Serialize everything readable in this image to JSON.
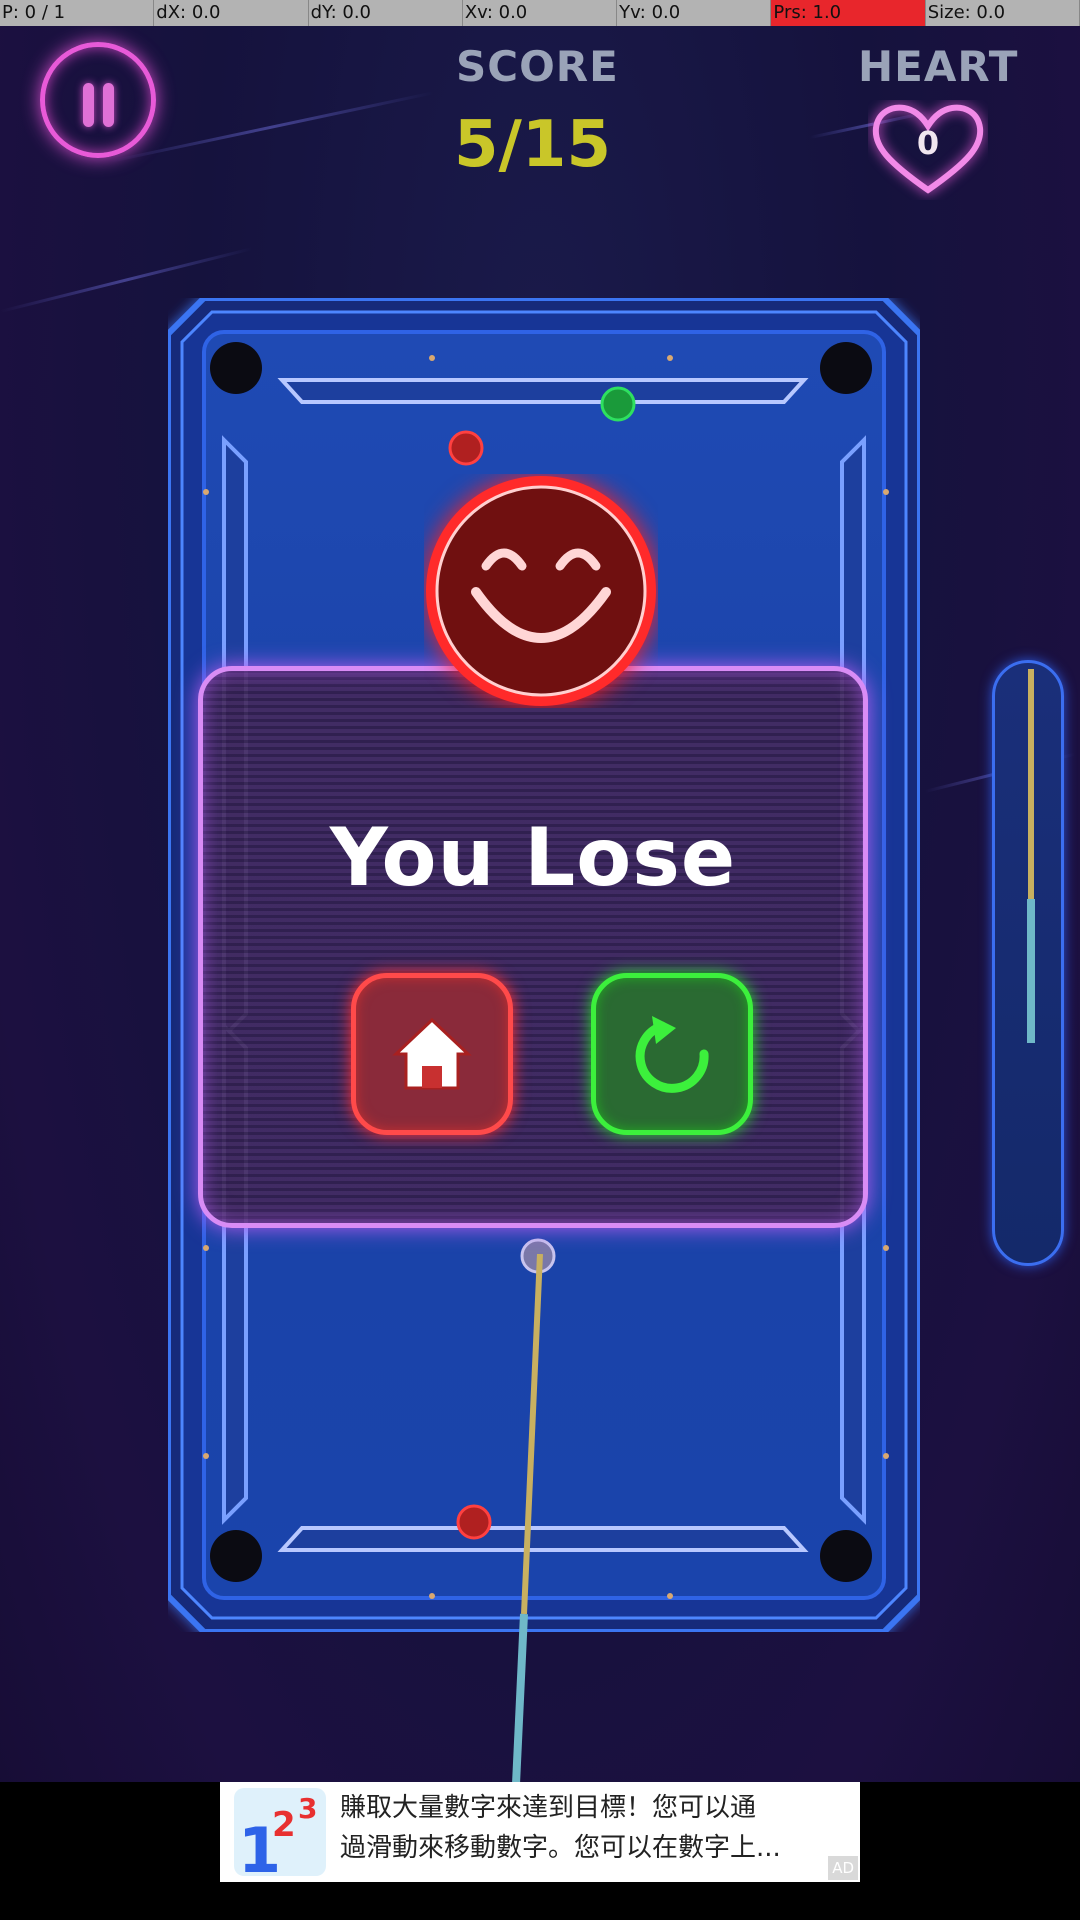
{
  "debug_bar": {
    "cells": [
      {
        "text": "P: 0 / 1"
      },
      {
        "text": "dX: 0.0"
      },
      {
        "text": "dY: 0.0"
      },
      {
        "text": "Xv: 0.0"
      },
      {
        "text": "Yv: 0.0"
      },
      {
        "text": "Prs: 1.0",
        "highlight": true
      },
      {
        "text": "Size: 0.0"
      }
    ]
  },
  "hud": {
    "score_label": "SCORE",
    "score_value": "5/15",
    "heart_label": "HEART",
    "heart_count": "0"
  },
  "popup": {
    "title": "You Lose",
    "home_button": "home-icon",
    "retry_button": "retry-icon"
  },
  "ad": {
    "line1": "賺取大量數字來達到目標！您可以通",
    "line2": "過滑動來移動數字。您可以在數字上...",
    "badge": "AD"
  },
  "colors": {
    "neon_pink": "#e85ad8",
    "score_yellow": "#c9c629",
    "table_blue": "#2b5fe0",
    "popup_border": "#d98cf5",
    "home_red": "#ff4a4a",
    "retry_green": "#3cf03c",
    "smiley_red": "#ff2a2a"
  }
}
